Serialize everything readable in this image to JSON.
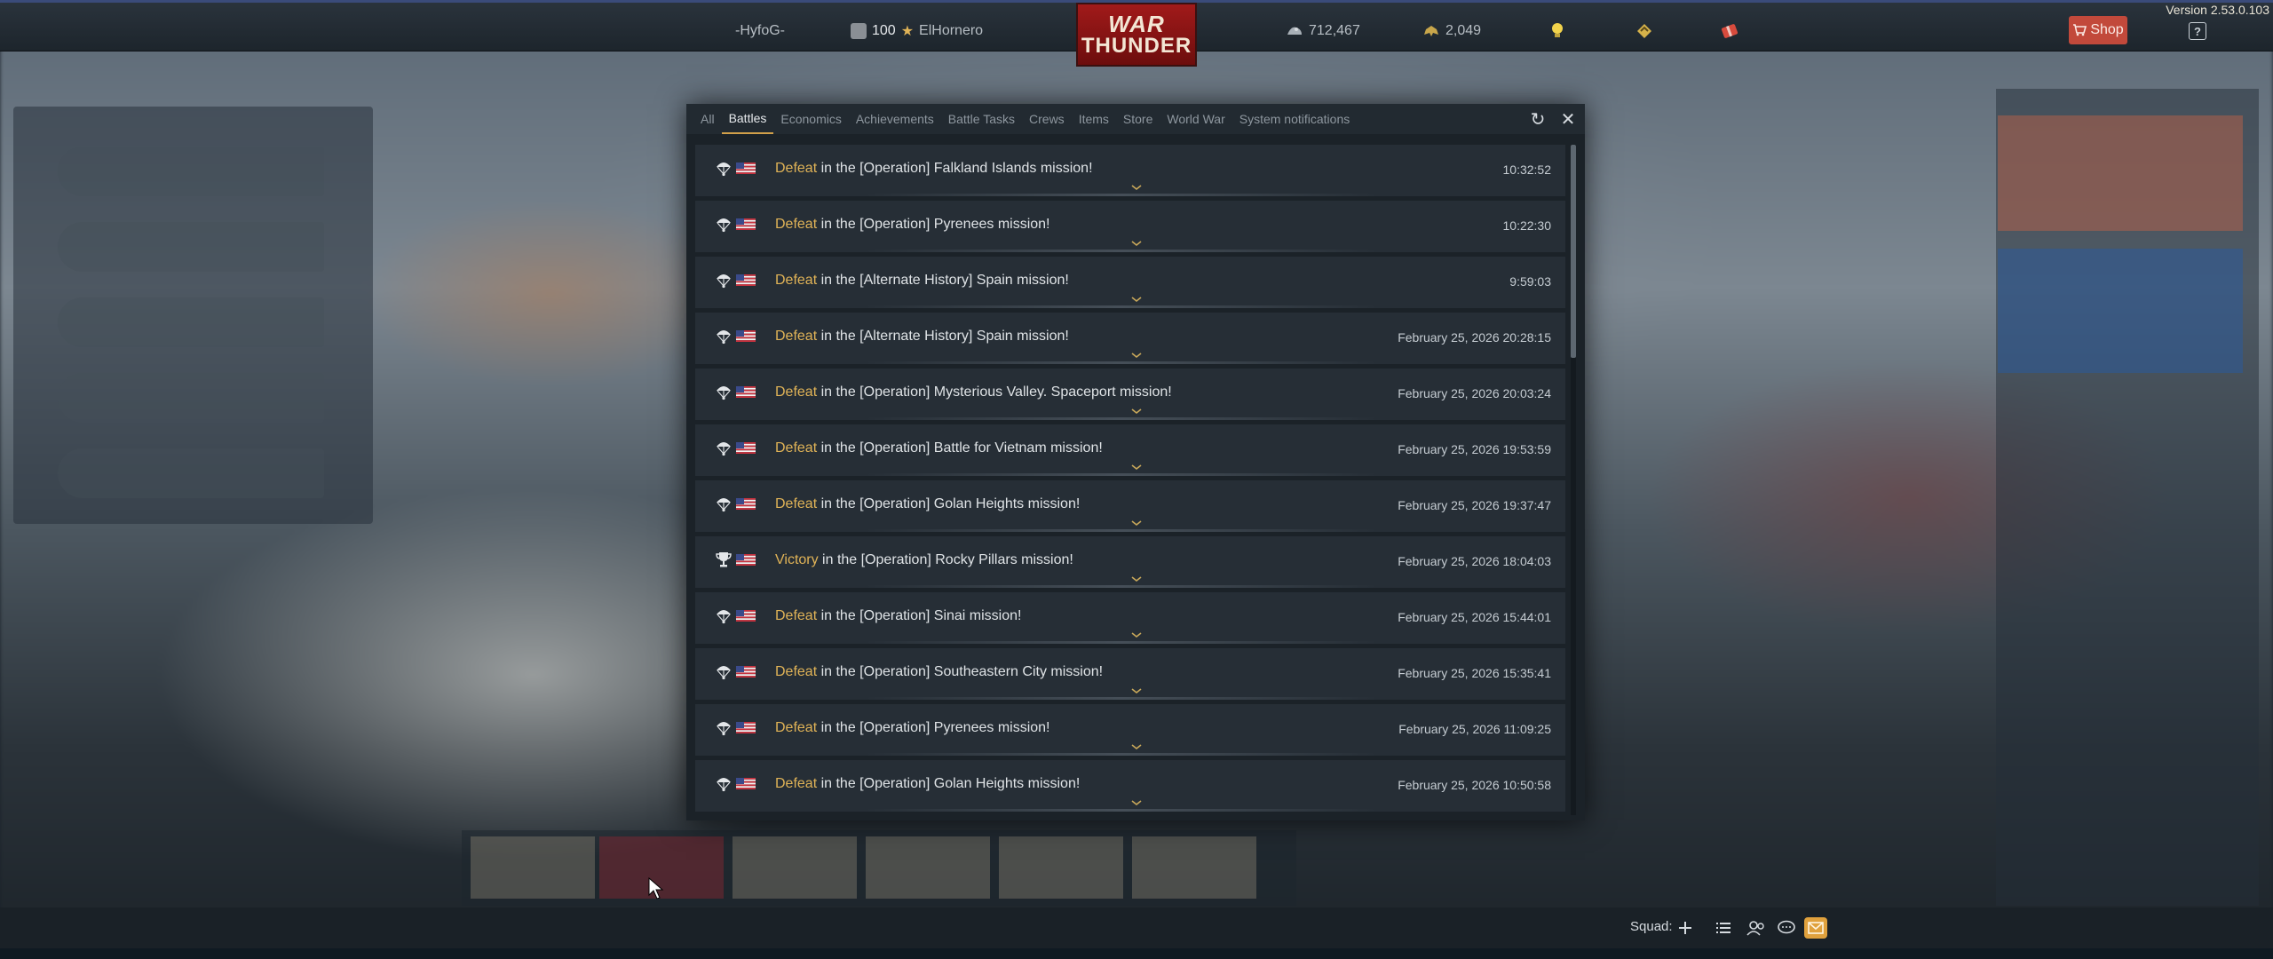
{
  "version": "Version 2.53.0.103",
  "topbar": {
    "squadron_tag": "-HyfoG-",
    "rank_level": "100",
    "username": "ElHornero",
    "silver_lions": "712,467",
    "golden_eagles": "2,049",
    "logo_line1": "WAR",
    "logo_line2": "THUNDER",
    "shop_label": "Shop",
    "help_label": "?"
  },
  "dialog": {
    "tabs": [
      {
        "label": "All",
        "active": false
      },
      {
        "label": "Battles",
        "active": true
      },
      {
        "label": "Economics",
        "active": false
      },
      {
        "label": "Achievements",
        "active": false
      },
      {
        "label": "Battle Tasks",
        "active": false
      },
      {
        "label": "Crews",
        "active": false
      },
      {
        "label": "Items",
        "active": false
      },
      {
        "label": "Store",
        "active": false
      },
      {
        "label": "World War",
        "active": false
      },
      {
        "label": "System notifications",
        "active": false
      }
    ],
    "refresh_icon": "↻",
    "close_icon": "✕",
    "notifications": [
      {
        "result": "Defeat",
        "text": " in the [Operation] Falkland Islands mission!",
        "time": "10:32:52",
        "icon": "parachute"
      },
      {
        "result": "Defeat",
        "text": " in the [Operation] Pyrenees mission!",
        "time": "10:22:30",
        "icon": "parachute"
      },
      {
        "result": "Defeat",
        "text": " in the [Alternate History] Spain mission!",
        "time": "9:59:03",
        "icon": "parachute"
      },
      {
        "result": "Defeat",
        "text": " in the [Alternate History] Spain mission!",
        "time": "February 25, 2026 20:28:15",
        "icon": "parachute"
      },
      {
        "result": "Defeat",
        "text": " in the [Operation] Mysterious Valley. Spaceport mission!",
        "time": "February 25, 2026 20:03:24",
        "icon": "parachute"
      },
      {
        "result": "Defeat",
        "text": " in the [Operation] Battle for Vietnam mission!",
        "time": "February 25, 2026 19:53:59",
        "icon": "parachute"
      },
      {
        "result": "Defeat",
        "text": " in the [Operation] Golan Heights mission!",
        "time": "February 25, 2026 19:37:47",
        "icon": "parachute"
      },
      {
        "result": "Victory",
        "text": " in the [Operation] Rocky Pillars mission!",
        "time": "February 25, 2026 18:04:03",
        "icon": "trophy"
      },
      {
        "result": "Defeat",
        "text": " in the [Operation] Sinai mission!",
        "time": "February 25, 2026 15:44:01",
        "icon": "parachute"
      },
      {
        "result": "Defeat",
        "text": " in the [Operation] Southeastern City mission!",
        "time": "February 25, 2026 15:35:41",
        "icon": "parachute"
      },
      {
        "result": "Defeat",
        "text": " in the [Operation] Pyrenees mission!",
        "time": "February 25, 2026 11:09:25",
        "icon": "parachute"
      },
      {
        "result": "Defeat",
        "text": " in the [Operation] Golan Heights mission!",
        "time": "February 25, 2026 10:50:58",
        "icon": "parachute"
      }
    ]
  },
  "bottombar": {
    "squad_label": "Squad:"
  },
  "colors": {
    "accent_gold": "#e0b357",
    "shop_red": "#c2493b",
    "mail_orange": "#e0a13d"
  }
}
